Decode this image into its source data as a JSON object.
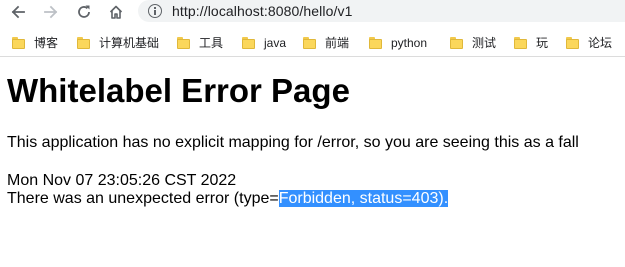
{
  "browser": {
    "url": "http://localhost:8080/hello/v1",
    "bookmarks": [
      {
        "label": "博客",
        "icon": "folder-icon"
      },
      {
        "label": "计算机基础",
        "icon": "folder-icon"
      },
      {
        "label": "工具",
        "icon": "folder-icon"
      },
      {
        "label": "java",
        "icon": "folder-icon"
      },
      {
        "label": "前端",
        "icon": "folder-icon"
      },
      {
        "label": "python",
        "icon": "folder-icon"
      },
      {
        "label": "测试",
        "icon": "folder-icon"
      },
      {
        "label": "玩",
        "icon": "folder-icon"
      },
      {
        "label": "论坛",
        "icon": "folder-icon"
      }
    ]
  },
  "page": {
    "title": "Whitelabel Error Page",
    "description": "This application has no explicit mapping for /error, so you are seeing this as a fall",
    "timestamp": "Mon Nov 07 23:05:26 CST 2022",
    "error_prefix": "There was an unexpected error (type=",
    "error_selected": "Forbidden, status=403)."
  },
  "colors": {
    "selection": "#3390ff",
    "folder": "#fbd75b",
    "omnibox": "#f1f3f4"
  }
}
